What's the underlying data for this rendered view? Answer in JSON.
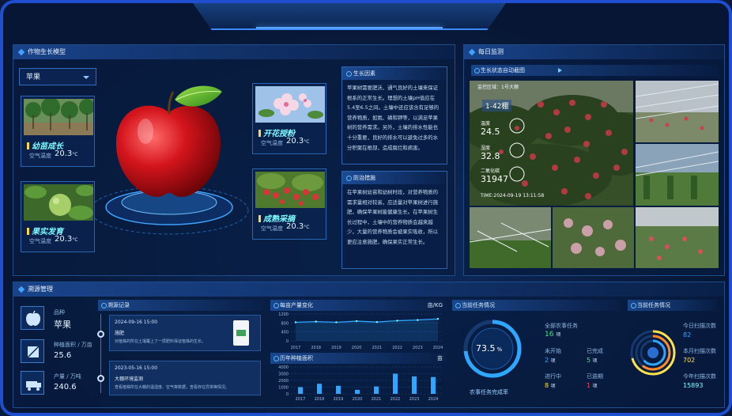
{
  "crop_panel": {
    "title": "作物生长模型",
    "crop_select": "苹果",
    "stages": [
      {
        "name": "幼苗成长",
        "temp_label": "空气温度",
        "temp_value": "20.3",
        "unit": "°C"
      },
      {
        "name": "果实发育",
        "temp_label": "空气温度",
        "temp_value": "20.3",
        "unit": "°C"
      },
      {
        "name": "开花授粉",
        "temp_label": "空气温度",
        "temp_value": "20.3",
        "unit": "°C"
      },
      {
        "name": "成熟采摘",
        "temp_label": "空气温度",
        "temp_value": "20.3",
        "unit": "°C"
      }
    ],
    "growth_factors": {
      "title": "生长因素",
      "text": "苹果树需要肥沃、通气良好的土壤来保证根系的正常生长。理想的土壤pH值应在5.4至6.5之间。土壤中还应该含有足够的营养物质，如氮、磷和钾等，以满足苹果树的营养需求。另外，土壤的排水性能也十分重要，良好的排水可以避免过多的水分积聚在根部，造成腐烂和病害。"
    },
    "prevention": {
      "title": "防治措施",
      "text": "在苹果树幼苗和幼树时段，对营养物质的需求量相对较高，应适量对苹果树进行施肥，确保苹果树能健康生长。在苹果树生长过程中，土壤中的营养物质会越来越少，大量的营养物质会被果实吸收，所以更应注意施肥，确保果实正常生长。"
    }
  },
  "monitor_panel": {
    "title": "每日监测",
    "subtitle": "生长状态自动截图",
    "overlay": {
      "area": "监控区域：1号大棚",
      "area_short": "1-42棚",
      "temp_label": "温度",
      "temp_value": "24.5",
      "humidity_label": "湿度",
      "humidity_value": "32.8",
      "co2_label": "二氧化碳",
      "co2_value": "31947",
      "time": "TIME:2024-09-19 13:11:58"
    }
  },
  "trace_panel": {
    "title": "溯源管理",
    "variety_label": "品种",
    "variety_value": "苹果",
    "area_label": "种植面积 / 万亩",
    "area_value": "25.6",
    "yield_label": "产量 / 万吨",
    "yield_value": "240.6",
    "records_title": "溯源记录",
    "records": [
      {
        "date": "2024-09-16 15:00",
        "title": "施肥",
        "desc": "对植株的所在土壤覆上了一层肥料保证植株的生长。"
      },
      {
        "date": "2023-05-16 15:00",
        "title": "大棚环境监测",
        "desc": "查看植株所在大棚的温湿度、空气等数据，查看存在异常等情况。"
      }
    ]
  },
  "area_change": {
    "title": "每亩产量变化",
    "unit": "亩/KG",
    "chart_data": {
      "type": "line",
      "categories": [
        "2017",
        "2018",
        "2019",
        "2020",
        "2021",
        "2022",
        "2023",
        "2024"
      ],
      "values": [
        830,
        860,
        830,
        880,
        840,
        900,
        930,
        980
      ],
      "yticks": [
        "1200",
        "800",
        "400",
        "0"
      ],
      "ylim": [
        0,
        1200
      ]
    }
  },
  "history_area": {
    "title": "历年种植面积",
    "unit": "亩",
    "chart_data": {
      "type": "bar",
      "categories": [
        "2017",
        "2018",
        "2019",
        "2020",
        "2021",
        "2022",
        "2023",
        "2024"
      ],
      "values": [
        1000,
        1500,
        1200,
        600,
        1100,
        3000,
        2600,
        2500
      ],
      "yticks": [
        "4000",
        "3000",
        "2000",
        "1000",
        "0"
      ],
      "ylim": [
        0,
        4000
      ]
    }
  },
  "task_panel": {
    "title": "当前任务情况",
    "completion_value": "73.5",
    "completion_unit": "%",
    "completion_label": "农事任务完成率",
    "all_label": "全部农事任务",
    "all_value": "16",
    "unit": "项",
    "not_started_label": "未开始",
    "not_started_value": "2",
    "done_label": "已完成",
    "done_value": "5",
    "in_progress_label": "进行中",
    "in_progress_value": "8",
    "overdue_label": "已逾期",
    "overdue_value": "1"
  },
  "scan_panel": {
    "title": "当前任务情况",
    "today_label": "今日扫描次数",
    "today_value": "82",
    "month_label": "本月扫描次数",
    "month_value": "702",
    "year_label": "今年扫描次数",
    "year_value": "15893"
  },
  "colors": {
    "accent": "#3fa2ff",
    "cyan": "#7ffcff",
    "yellow": "#ffe14a",
    "orange": "#ff8a2a",
    "red": "#ff4a4a",
    "green": "#3ee87a"
  }
}
